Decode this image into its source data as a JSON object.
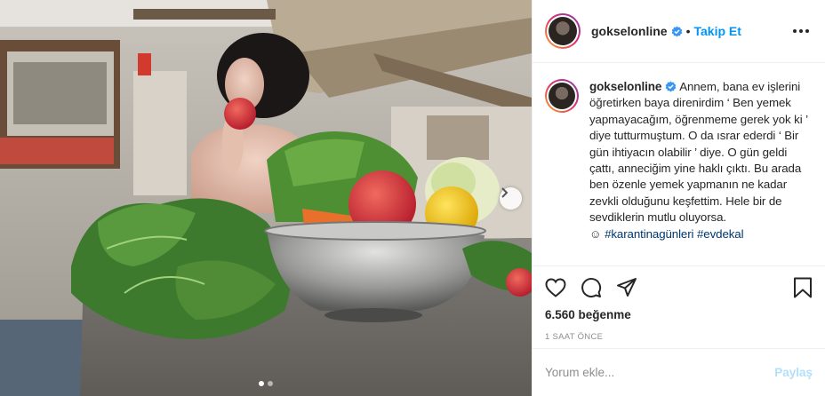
{
  "post": {
    "author": {
      "username": "gokselonline",
      "verified": true,
      "follow_label": "Takip Et",
      "separator": "•"
    },
    "caption": {
      "username": "gokselonline",
      "text": "Annem, bana ev işlerini öğretirken baya direnirdim ‘ Ben yemek yapmayacağım, öğrenmeme gerek yok ki ’ diye tutturmuştum. O da ısrar ederdi ‘ Bir gün ihtiyacın olabilir ’ diye. O gün geldi çattı, anneciğim yine haklı çıktı. Bu arada ben özenle yemek yapmanın ne kadar zevkli olduğunu keşfettim. Hele bir de sevdiklerin mutlu oluyorsa.",
      "emoji": "☺",
      "hashtags": [
        "#karantinagünleri",
        "#evdekal"
      ]
    },
    "likes": "6.560 beğenme",
    "time": "1 SAAT ÖNCE",
    "comment_box": {
      "placeholder": "Yorum ekle...",
      "share_label": "Paylaş"
    },
    "carousel": {
      "current": 1,
      "total": 2
    },
    "icons": {
      "like": "heart-icon",
      "comment": "comment-icon",
      "share": "paper-plane-icon",
      "save": "bookmark-icon",
      "more": "more-options-icon",
      "next": "chevron-right-icon",
      "verified": "verified-badge-icon"
    },
    "colors": {
      "follow_blue": "#0095f6",
      "verified_blue": "#3897f0",
      "hashtag": "#00376b",
      "muted": "#8e8e8e",
      "share_disabled": "#b2dffc"
    }
  }
}
